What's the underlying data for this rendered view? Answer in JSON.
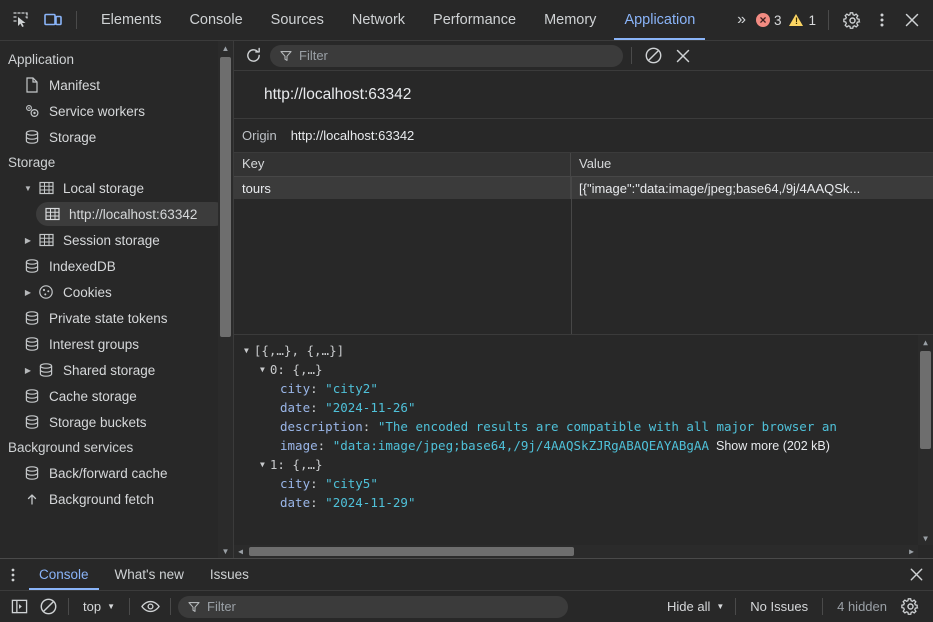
{
  "topbar": {
    "inspect_icon": "inspect-element-icon",
    "device_icon": "device-toolbar-icon",
    "tabs": [
      {
        "label": "Elements",
        "active": false
      },
      {
        "label": "Console",
        "active": false
      },
      {
        "label": "Sources",
        "active": false
      },
      {
        "label": "Network",
        "active": false
      },
      {
        "label": "Performance",
        "active": false
      },
      {
        "label": "Memory",
        "active": false
      },
      {
        "label": "Application",
        "active": true
      }
    ],
    "more_tabs": "»",
    "error_count": "3",
    "warning_count": "1",
    "settings_icon": "gear-icon",
    "menu_icon": "kebab-menu-icon",
    "close_icon": "close-icon",
    "accent_color": "#8ab4f8",
    "error_color": "#f28b82",
    "warning_color": "#fdd663"
  },
  "sidebar": {
    "sections": [
      {
        "title": "Application",
        "items": [
          {
            "label": "Manifest",
            "icon": "document-icon",
            "depth": 1,
            "arrow": "none",
            "selected": false
          },
          {
            "label": "Service workers",
            "icon": "gears-icon",
            "depth": 1,
            "arrow": "none",
            "selected": false
          },
          {
            "label": "Storage",
            "icon": "database-icon",
            "depth": 1,
            "arrow": "none",
            "selected": false
          }
        ]
      },
      {
        "title": "Storage",
        "items": [
          {
            "label": "Local storage",
            "icon": "table-icon",
            "depth": 1,
            "arrow": "expanded",
            "selected": false
          },
          {
            "label": "http://localhost:63342",
            "icon": "table-icon",
            "depth": 2,
            "arrow": "none",
            "selected": true
          },
          {
            "label": "Session storage",
            "icon": "table-icon",
            "depth": 1,
            "arrow": "collapsed",
            "selected": false
          },
          {
            "label": "IndexedDB",
            "icon": "database-icon",
            "depth": 1,
            "arrow": "none",
            "selected": false
          },
          {
            "label": "Cookies",
            "icon": "cookie-icon",
            "depth": 1,
            "arrow": "collapsed",
            "selected": false
          },
          {
            "label": "Private state tokens",
            "icon": "database-icon",
            "depth": 1,
            "arrow": "none",
            "selected": false
          },
          {
            "label": "Interest groups",
            "icon": "database-icon",
            "depth": 1,
            "arrow": "none",
            "selected": false
          },
          {
            "label": "Shared storage",
            "icon": "database-icon",
            "depth": 1,
            "arrow": "collapsed",
            "selected": false
          },
          {
            "label": "Cache storage",
            "icon": "database-icon",
            "depth": 1,
            "arrow": "none",
            "selected": false
          },
          {
            "label": "Storage buckets",
            "icon": "database-icon",
            "depth": 1,
            "arrow": "none",
            "selected": false
          }
        ]
      },
      {
        "title": "Background services",
        "items": [
          {
            "label": "Back/forward cache",
            "icon": "database-icon",
            "depth": 1,
            "arrow": "none",
            "selected": false
          },
          {
            "label": "Background fetch",
            "icon": "arrow-up-icon",
            "depth": 1,
            "arrow": "none",
            "selected": false
          }
        ]
      }
    ]
  },
  "panel": {
    "refresh_icon": "refresh-icon",
    "filter_icon": "funnel-icon",
    "filter_placeholder": "Filter",
    "filter_value": "",
    "clear_icon": "clear-icon",
    "delete_icon": "close-icon",
    "title": "http://localhost:63342",
    "origin_label": "Origin",
    "origin_value": "http://localhost:63342"
  },
  "table": {
    "columns": [
      "Key",
      "Value"
    ],
    "rows": [
      {
        "key": "tours",
        "value": "[{\"image\":\"data:image/jpeg;base64,/9j/4AAQSk...",
        "selected": true
      }
    ]
  },
  "preview": {
    "lines": [
      {
        "indent": 0,
        "arrow": "expanded",
        "text": "[{,…}, {,…}]",
        "kind": "root"
      },
      {
        "indent": 1,
        "arrow": "expanded",
        "key": "0",
        "text": "{,…}",
        "kind": "index"
      },
      {
        "indent": 2,
        "arrow": "none",
        "key": "city",
        "value": "\"city2\"",
        "kind": "prop"
      },
      {
        "indent": 2,
        "arrow": "none",
        "key": "date",
        "value": "\"2024-11-26\"",
        "kind": "prop"
      },
      {
        "indent": 2,
        "arrow": "none",
        "key": "description",
        "value": "\"The encoded results are compatible with all major browser an",
        "kind": "prop"
      },
      {
        "indent": 2,
        "arrow": "none",
        "key": "image",
        "value": "\"data:image/jpeg;base64,/9j/4AAQSkZJRgABAQEAYABgAA",
        "more": "Show more (202 kB)",
        "kind": "prop"
      },
      {
        "indent": 1,
        "arrow": "expanded",
        "key": "1",
        "text": "{,…}",
        "kind": "index"
      },
      {
        "indent": 2,
        "arrow": "none",
        "key": "city",
        "value": "\"city5\"",
        "kind": "prop"
      },
      {
        "indent": 2,
        "arrow": "none",
        "key": "date",
        "value": "\"2024-11-29\"",
        "kind": "prop"
      }
    ]
  },
  "drawer": {
    "menu_icon": "kebab-menu-icon",
    "tabs": [
      {
        "label": "Console",
        "active": true
      },
      {
        "label": "What's new",
        "active": false
      },
      {
        "label": "Issues",
        "active": false
      }
    ],
    "close_icon": "close-icon",
    "sidebar_toggle_icon": "show-console-sidebar-icon",
    "clear_icon": "clear-console-icon",
    "context_label": "top",
    "eye_icon": "live-expression-icon",
    "filter_icon": "funnel-icon",
    "filter_placeholder": "Filter",
    "filter_value": "",
    "levels_label": "Hide all",
    "issues_label": "No Issues",
    "hidden_label": "4 hidden",
    "settings_icon": "gear-icon"
  }
}
